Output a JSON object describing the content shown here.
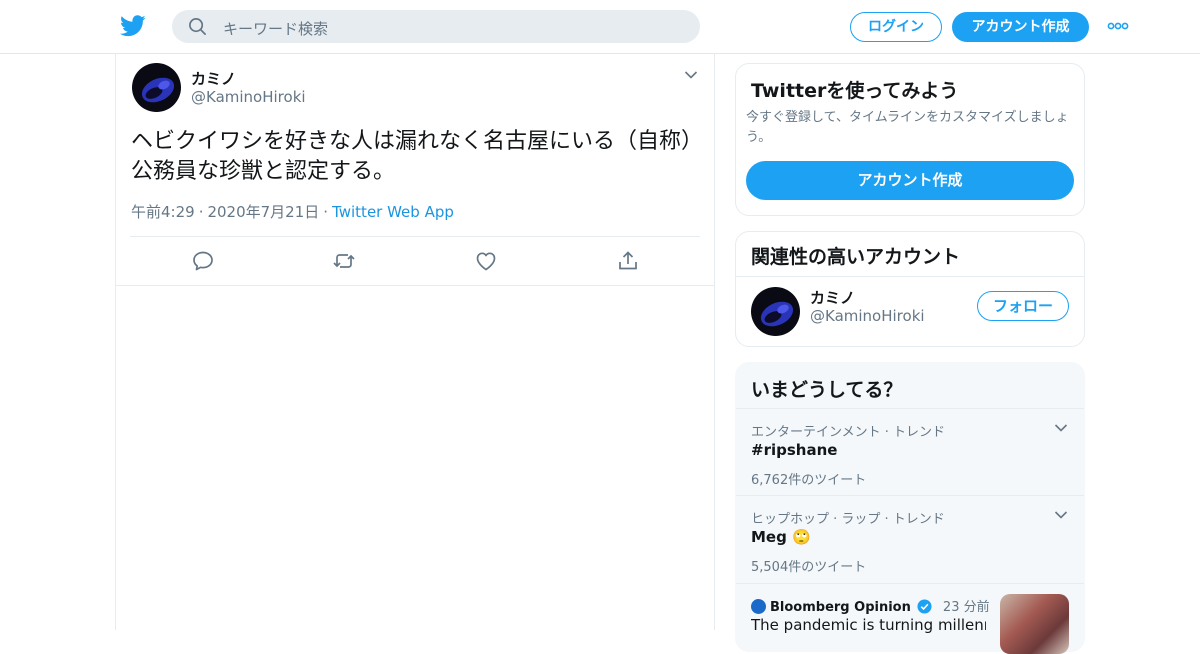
{
  "header": {
    "search_placeholder": "キーワード検索",
    "login_label": "ログイン",
    "signup_label": "アカウント作成",
    "brand_color": "#1da1f2"
  },
  "tweet": {
    "name": "カミノ",
    "handle": "@KaminoHiroki",
    "text": "ヘビクイワシを好きな人は漏れなく名古屋にいる（自称）公務員な珍獣と認定する。",
    "time": "午前4:29",
    "date": "2020年7月21日",
    "source": "Twitter Web App",
    "meta_separator": "·"
  },
  "signup_card": {
    "title": "Twitterを使ってみよう",
    "description": "今すぐ登録して、タイムラインをカスタマイズしましょう。",
    "button_label": "アカウント作成"
  },
  "related": {
    "title": "関連性の高いアカウント",
    "name": "カミノ",
    "handle": "@KaminoHiroki",
    "follow_label": "フォロー"
  },
  "trends": {
    "title": "いまどうしてる？",
    "items": [
      {
        "category": "エンターテインメント · トレンド",
        "name": "#ripshane",
        "count": "6,762件のツイート"
      },
      {
        "category": "ヒップホップ · ラップ · トレンド",
        "name": "Meg 🙄",
        "count": "5,504件のツイート"
      }
    ],
    "news": {
      "source": "Bloomberg Opinion",
      "time": "23 分前",
      "headline": "The pandemic is turning millennials"
    }
  }
}
